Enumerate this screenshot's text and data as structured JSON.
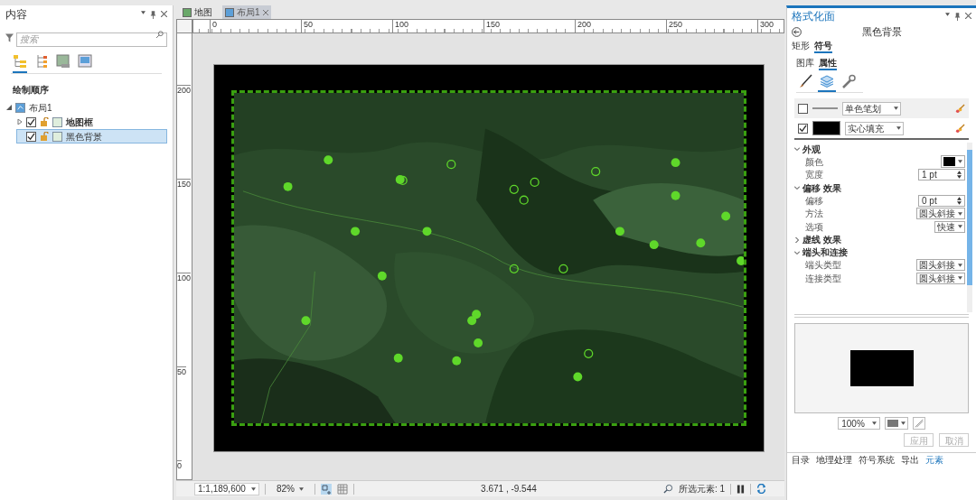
{
  "contents_pane": {
    "title": "内容",
    "search": {
      "placeholder": "搜索"
    },
    "view_tabs": [
      {
        "selected": true
      },
      {
        "selected": false
      },
      {
        "selected": false
      },
      {
        "selected": false
      }
    ],
    "heading": "绘制顺序",
    "tree": [
      {
        "label": "布局1",
        "expanded": true,
        "children": [
          {
            "label": "地图框",
            "checked": true,
            "expanded": false,
            "selected": false
          },
          {
            "label": "黑色背景",
            "checked": true,
            "selected": true
          }
        ]
      }
    ]
  },
  "view_tabs": [
    {
      "label": "地图",
      "selected": false,
      "closable": false
    },
    {
      "label": "布局1",
      "selected": true,
      "closable": true
    }
  ],
  "ruler": {
    "x_ticks": [
      "0",
      "50",
      "100",
      "150",
      "200",
      "250",
      "300"
    ],
    "y_ticks": [
      "200",
      "150",
      "100",
      "50",
      "0"
    ]
  },
  "status_bar": {
    "scale": "1:1,189,600",
    "zoom": "82%",
    "coordinates": "3.671 , -9.544",
    "selection": "所选元素: 1"
  },
  "format_pane": {
    "title": "格式化面",
    "element_name": "黑色背景",
    "tabs": [
      {
        "label": "矩形",
        "selected": false
      },
      {
        "label": "符号",
        "selected": true
      }
    ],
    "subtabs": [
      {
        "label": "图库",
        "selected": false
      },
      {
        "label": "属性",
        "selected": true
      }
    ],
    "icon_tabs": [
      {
        "kind": "brush",
        "selected": false
      },
      {
        "kind": "layers",
        "selected": true
      },
      {
        "kind": "wrench",
        "selected": false
      }
    ],
    "layers": [
      {
        "kind": "stroke",
        "checked": false,
        "type": "单色笔划"
      },
      {
        "kind": "fill",
        "checked": true,
        "type": "实心填充"
      }
    ],
    "sections": [
      {
        "label": "外观",
        "expanded": true,
        "rows": [
          {
            "kind": "color",
            "label": "颜色"
          },
          {
            "kind": "spinner",
            "label": "宽度",
            "value": "1 pt"
          }
        ]
      },
      {
        "label": "偏移 效果",
        "expanded": true,
        "rows": [
          {
            "kind": "spinner",
            "label": "偏移",
            "value": "0 pt"
          },
          {
            "kind": "dropdown",
            "label": "方法",
            "value": "圆头斜接"
          },
          {
            "kind": "dropdown",
            "label": "选项",
            "value": "快速"
          }
        ]
      },
      {
        "label": "虚线 效果",
        "expanded": false
      },
      {
        "label": "端头和连接",
        "expanded": true,
        "rows": [
          {
            "kind": "dropdown",
            "label": "端头类型",
            "value": "圆头斜接"
          },
          {
            "kind": "dropdown",
            "label": "连接类型",
            "value": "圆头斜接"
          }
        ]
      }
    ],
    "preview_zoom": "100%",
    "buttons": [
      {
        "label": "应用",
        "disabled": true
      },
      {
        "label": "取消",
        "disabled": true
      }
    ]
  },
  "bottom_tabs": [
    {
      "label": "目录",
      "selected": false
    },
    {
      "label": "地理处理",
      "selected": false
    },
    {
      "label": "符号系统",
      "selected": false
    },
    {
      "label": "导出",
      "selected": false
    },
    {
      "label": "元素",
      "selected": true
    }
  ]
}
